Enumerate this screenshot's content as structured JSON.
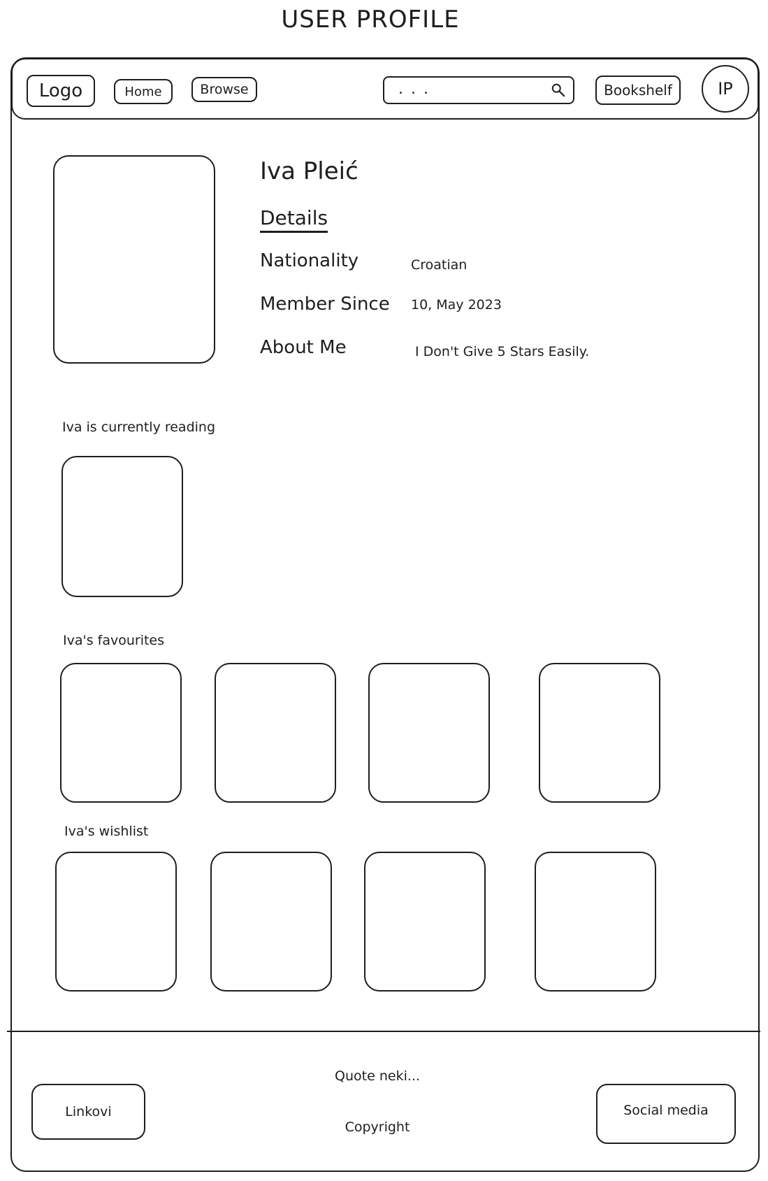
{
  "page": {
    "title": "USER PROFILE"
  },
  "nav": {
    "logo": "Logo",
    "home": "Home",
    "browse": "Browse",
    "search_value": ". . .",
    "bookshelf": "Bookshelf",
    "avatar_initials": "IP"
  },
  "profile": {
    "name": "Iva Pleić",
    "details_heading": "Details",
    "fields": [
      {
        "label": "Nationality",
        "value": "Croatian"
      },
      {
        "label": "Member Since",
        "value": "10, May 2023"
      },
      {
        "label": "About Me",
        "value": "I Don't Give 5 Stars Easily."
      }
    ]
  },
  "sections": {
    "currently_reading": "Iva is currently reading",
    "favourites": "Iva's favourites",
    "wishlist": "Iva's wishlist"
  },
  "footer": {
    "quote": "Quote neki...",
    "copyright": "Copyright",
    "links": "Linkovi",
    "social": "Social media"
  },
  "icons": {
    "search": "search-icon",
    "profile_photo": "profile-photo-placeholder",
    "book_cover": "book-cover-placeholder"
  }
}
